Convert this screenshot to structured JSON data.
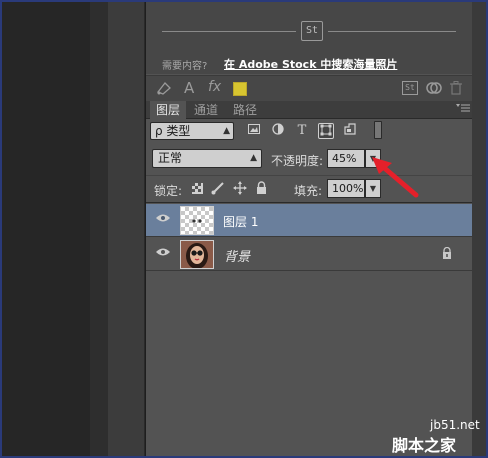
{
  "stock": {
    "badge": "St",
    "need_label": "需要内容?",
    "link_label": "在 Adobe Stock 中搜索海量照片"
  },
  "libbar": {
    "icons": [
      "fill-path-icon",
      "text-style-icon",
      "fx-icon",
      "color-swatch",
      "stock-icon",
      "link-icon",
      "trash-icon"
    ],
    "text_glyph": "A",
    "fx_glyph": "fx",
    "stock_glyph": "St",
    "swatch_color": "#d7c530"
  },
  "tabs": [
    {
      "label": "图层",
      "active": true
    },
    {
      "label": "通道",
      "active": false
    },
    {
      "label": "路径",
      "active": false
    }
  ],
  "filter": {
    "kind_label": "ρ 类型",
    "icons": [
      "image-filter-icon",
      "adjustment-filter-icon",
      "type-filter-icon",
      "shape-filter-icon",
      "smart-object-filter-icon"
    ],
    "type_glyph": "T"
  },
  "blend": {
    "mode": "正常",
    "opacity_label": "不透明度:",
    "opacity_value": "45%"
  },
  "lock": {
    "label": "锁定:",
    "fill_label": "填充:",
    "fill_value": "100%"
  },
  "layers": [
    {
      "name": "图层 1",
      "selected": true,
      "visible": true,
      "locked": false
    },
    {
      "name": "背景",
      "selected": false,
      "visible": true,
      "locked": true
    }
  ],
  "watermark": {
    "url": "jb51.net",
    "site": "脚本之家"
  },
  "colors": {
    "panel": "#535353",
    "selected_layer": "#6a7f9c",
    "arrow": "#e5202a"
  }
}
